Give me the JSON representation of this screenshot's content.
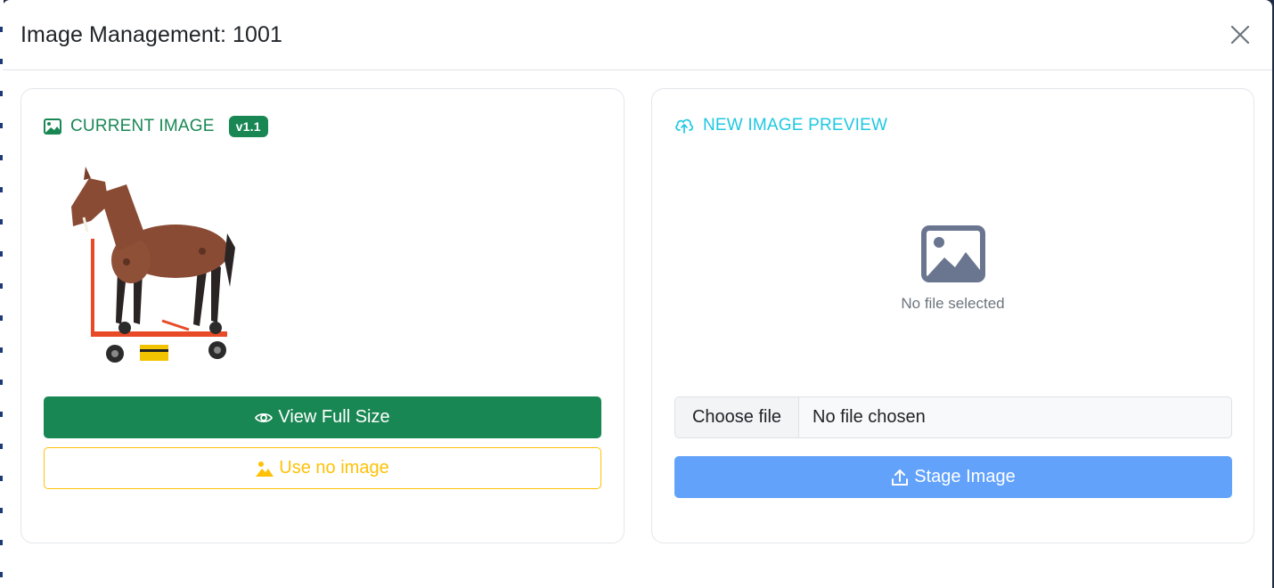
{
  "modal": {
    "title": "Image Management: 1001"
  },
  "current_image": {
    "heading": "CURRENT IMAGE",
    "version_badge": "v1.1",
    "image_description_icon": "image-icon",
    "view_full_size_label": "View Full Size",
    "use_no_image_label": "Use no image"
  },
  "new_image": {
    "heading": "NEW IMAGE PREVIEW",
    "heading_icon": "cloud-upload-icon",
    "placeholder_text": "No file selected",
    "choose_file_label": "Choose file",
    "file_status": "No file chosen",
    "stage_label": "Stage Image"
  },
  "colors": {
    "success": "#198754",
    "warning": "#ffc107",
    "info": "#1fc8e3",
    "primary_disabled": "#62a2fb"
  }
}
